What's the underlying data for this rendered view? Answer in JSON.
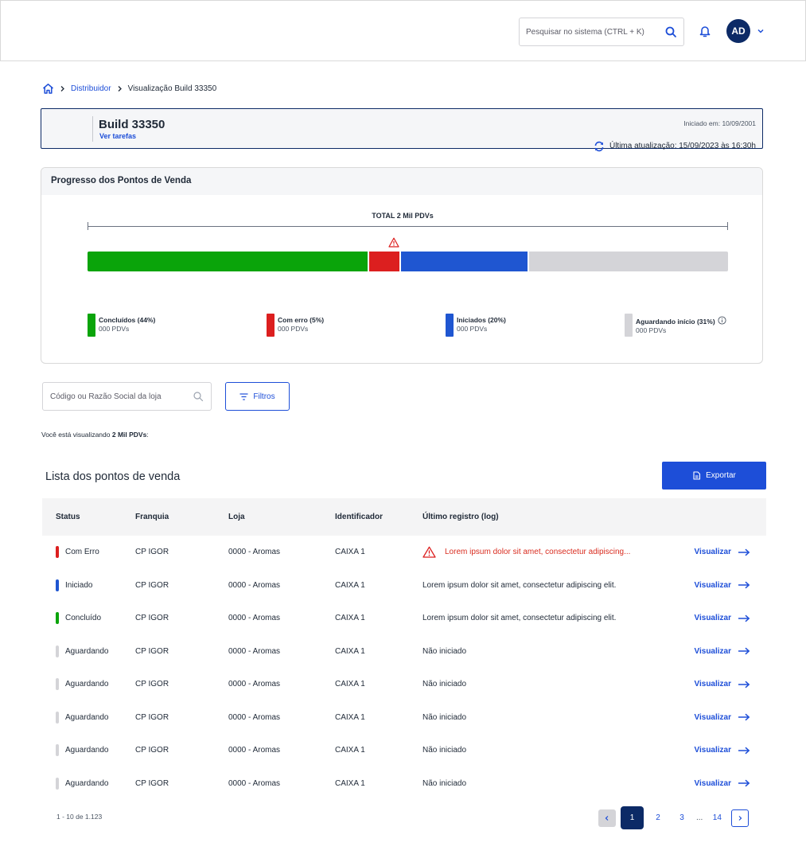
{
  "header": {
    "search_placeholder": "Pesquisar no sistema (CTRL + K)",
    "avatar_initials": "AD"
  },
  "breadcrumb": {
    "parent": "Distribuidor",
    "current": "Visualização Build 33350"
  },
  "build": {
    "title": "Build 33350",
    "tasks_link": "Ver tarefas",
    "started": "Iniciado em: 10/09/2001",
    "updated": "Última atualização: 15/09/2023 às 16:30h"
  },
  "progress": {
    "title": "Progresso dos Pontos de Venda",
    "total_label": "TOTAL 2 Mil PDVs",
    "segments": [
      {
        "label": "Concluídos (44%)",
        "count": "000 PDVs",
        "percent": 44,
        "color": "#0aa40a"
      },
      {
        "label": "Com erro (5%)",
        "count": "000 PDVs",
        "percent": 5,
        "color": "#dc1f1f"
      },
      {
        "label": "Iniciados (20%)",
        "count": "000 PDVs",
        "percent": 20,
        "color": "#1f56d1"
      },
      {
        "label": "Aguardando início (31%)",
        "count": "000 PDVs",
        "percent": 31,
        "color": "#d4d4d8"
      }
    ]
  },
  "filters": {
    "search_placeholder": "Código ou Razão Social da loja",
    "filter_button": "Filtros",
    "viewing_prefix": "Você está visualizando",
    "viewing_value": "2 Mil PDVs",
    "viewing_suffix": ":"
  },
  "list": {
    "title": "Lista dos pontos de venda",
    "export_button": "Exportar",
    "columns": [
      "Status",
      "Franquia",
      "Loja",
      "Identificador",
      "Último registro (log)"
    ],
    "action_label": "Visualizar",
    "rows": [
      {
        "status": "Com Erro",
        "status_color": "#dc1f1f",
        "franquia": "CP IGOR",
        "loja": "0000 - Aromas",
        "id": "CAIXA 1",
        "log": "Lorem ipsum dolor sit amet, consectetur adipiscing...",
        "error": true
      },
      {
        "status": "Iniciado",
        "status_color": "#1f56d1",
        "franquia": "CP IGOR",
        "loja": "0000 - Aromas",
        "id": "CAIXA 1",
        "log": "Lorem ipsum dolor sit amet, consectetur adipiscing elit.",
        "error": false
      },
      {
        "status": "Concluído",
        "status_color": "#0aa40a",
        "franquia": "CP IGOR",
        "loja": "0000 - Aromas",
        "id": "CAIXA 1",
        "log": "Lorem ipsum dolor sit amet, consectetur adipiscing elit.",
        "error": false
      },
      {
        "status": "Aguardando",
        "status_color": "#d4d4d8",
        "franquia": "CP IGOR",
        "loja": "0000 - Aromas",
        "id": "CAIXA 1",
        "log": "Não iniciado",
        "error": false
      },
      {
        "status": "Aguardando",
        "status_color": "#d4d4d8",
        "franquia": "CP IGOR",
        "loja": "0000 - Aromas",
        "id": "CAIXA 1",
        "log": "Não iniciado",
        "error": false
      },
      {
        "status": "Aguardando",
        "status_color": "#d4d4d8",
        "franquia": "CP IGOR",
        "loja": "0000 - Aromas",
        "id": "CAIXA 1",
        "log": "Não iniciado",
        "error": false
      },
      {
        "status": "Aguardando",
        "status_color": "#d4d4d8",
        "franquia": "CP IGOR",
        "loja": "0000 - Aromas",
        "id": "CAIXA 1",
        "log": "Não iniciado",
        "error": false
      },
      {
        "status": "Aguardando",
        "status_color": "#d4d4d8",
        "franquia": "CP IGOR",
        "loja": "0000 - Aromas",
        "id": "CAIXA 1",
        "log": "Não iniciado",
        "error": false
      }
    ]
  },
  "pagination": {
    "range": "1 - 10 de 1.123",
    "current": "1",
    "pages": [
      "2",
      "3"
    ],
    "ellipsis": "...",
    "last": "14"
  }
}
